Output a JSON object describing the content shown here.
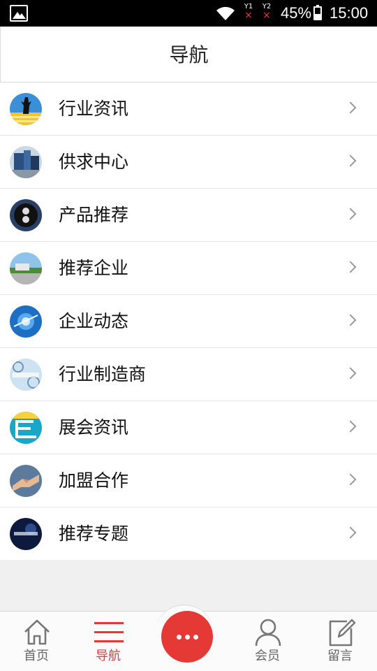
{
  "status_bar": {
    "sim1_label": "1",
    "sim2_label": "2",
    "battery_percent": "45%",
    "battery_level": 0.45,
    "time": "15:00"
  },
  "header": {
    "title": "导航"
  },
  "nav_items": [
    {
      "label": "行业资讯",
      "icon": "industry-news-thumb"
    },
    {
      "label": "供求中心",
      "icon": "supply-demand-thumb"
    },
    {
      "label": "产品推荐",
      "icon": "product-recommend-thumb"
    },
    {
      "label": "推荐企业",
      "icon": "recommended-company-thumb"
    },
    {
      "label": "企业动态",
      "icon": "company-news-thumb"
    },
    {
      "label": "行业制造商",
      "icon": "manufacturer-thumb"
    },
    {
      "label": "展会资讯",
      "icon": "exhibition-thumb"
    },
    {
      "label": "加盟合作",
      "icon": "partnership-thumb"
    },
    {
      "label": "推荐专题",
      "icon": "featured-topic-thumb"
    }
  ],
  "tab_bar": {
    "home": "首页",
    "nav": "导航",
    "member": "会员",
    "message": "留言"
  },
  "colors": {
    "accent": "#e53935",
    "inactive": "#666666"
  }
}
